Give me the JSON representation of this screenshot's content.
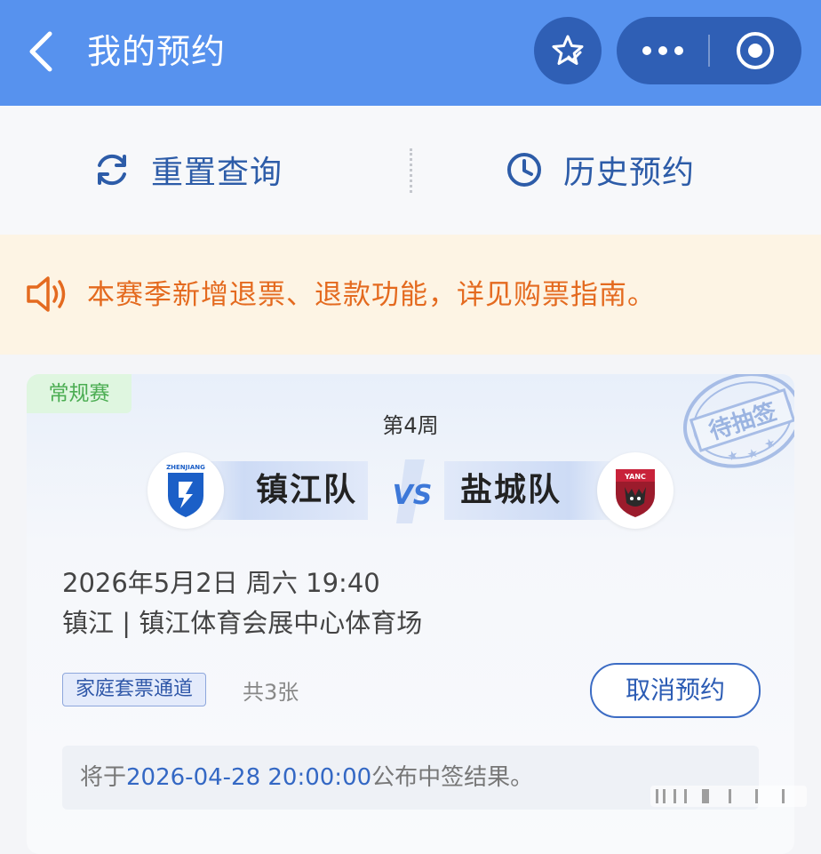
{
  "header": {
    "title": "我的预约",
    "icons": [
      "back-arrow-icon",
      "star-check-icon",
      "more-dots-icon",
      "target-circle-icon"
    ]
  },
  "actions": {
    "reset_label": "重置查询",
    "history_label": "历史预约"
  },
  "notice": {
    "text": "本赛季新增退票、退款功能，详见购票指南。"
  },
  "match": {
    "type_tag": "常规赛",
    "stamp_text": "待抽签",
    "round": "第4周",
    "home_team": "镇江队",
    "away_team": "盐城队",
    "home_logo_text": "ZHENJIANG",
    "away_logo_text": "YANC",
    "vs": "VS",
    "datetime": "2026年5月2日 周六 19:40",
    "venue": "镇江 | 镇江体育会展中心体育场",
    "channel": "家庭套票通道",
    "ticket_count": "共3张",
    "cancel_label": "取消预约",
    "result_prefix": "将于",
    "result_time": "2026-04-28 20:00:00",
    "result_suffix": "公布中签结果。"
  },
  "colors": {
    "header_bg": "#5792ee",
    "accent_blue": "#2d5ca8",
    "notice_orange": "#e46a1f",
    "tag_green": "#4bad52"
  }
}
